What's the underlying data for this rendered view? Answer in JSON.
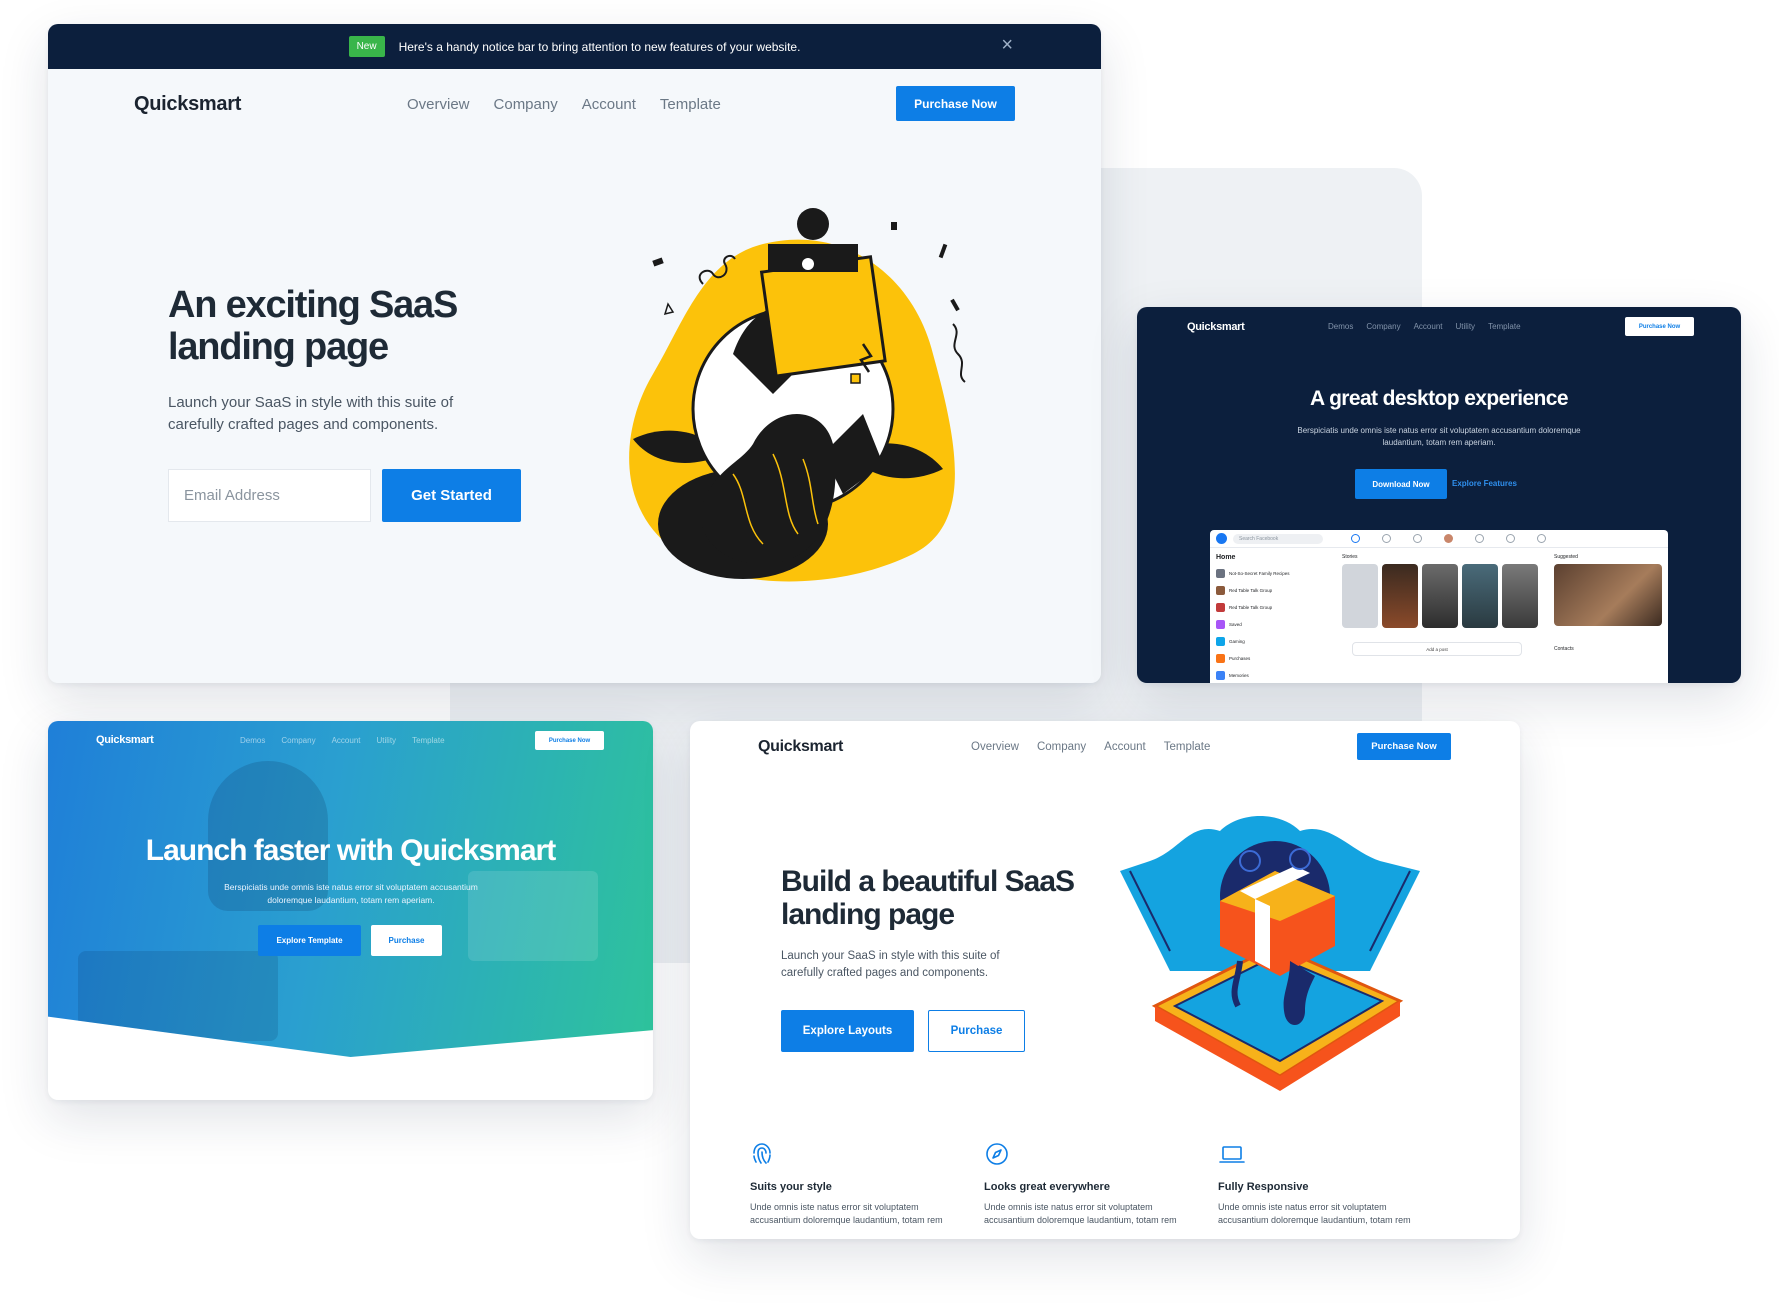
{
  "card_a": {
    "notice_badge": "New",
    "notice_text": "Here's a handy notice bar to bring attention to new features of your website.",
    "close_icon": "close-icon",
    "logo": "Quicksmart",
    "nav_links": [
      "Overview",
      "Company",
      "Account",
      "Template"
    ],
    "purchase_label": "Purchase Now",
    "title": "An exciting SaaS landing page",
    "subtitle": "Launch your SaaS in style with this suite of carefully crafted pages and components.",
    "email_placeholder": "Email Address",
    "cta_label": "Get Started"
  },
  "card_b": {
    "logo": "Quicksmart",
    "nav_links": [
      "Demos",
      "Company",
      "Account",
      "Utility",
      "Template"
    ],
    "purchase_label": "Purchase Now",
    "title": "A great desktop experience",
    "subtitle": "Berspiciatis unde omnis iste natus error sit voluptatem accusantium doloremque laudantium, totam rem aperiam.",
    "download_label": "Download Now",
    "explore_label": "Explore Features",
    "mock": {
      "search": "Search Facebook",
      "side_title": "Home",
      "side_items": [
        "Not-So-Secret Family Recipes",
        "Red Table Talk Group",
        "Red Table Talk Group",
        "Saved",
        "Gaming",
        "Purchases",
        "Memories"
      ],
      "stories_label": "Stories",
      "add_post": "Add a post",
      "suggested_label": "Suggested",
      "contacts_label": "Contacts"
    }
  },
  "card_c": {
    "logo": "Quicksmart",
    "nav_links": [
      "Demos",
      "Company",
      "Account",
      "Utility",
      "Template"
    ],
    "purchase_label": "Purchase Now",
    "title": "Launch faster with Quicksmart",
    "subtitle": "Berspiciatis unde omnis iste natus error sit voluptatem accusantium doloremque laudantium, totam rem aperiam.",
    "explore_label": "Explore Template",
    "purchase_btn": "Purchase"
  },
  "card_d": {
    "logo": "Quicksmart",
    "nav_links": [
      "Overview",
      "Company",
      "Account",
      "Template"
    ],
    "purchase_label": "Purchase Now",
    "title": "Build a beautiful SaaS landing page",
    "subtitle": "Launch your SaaS in style with this suite of carefully crafted pages and components.",
    "explore_label": "Explore Layouts",
    "purchase_btn": "Purchase",
    "features": [
      {
        "icon": "fingerprint-icon",
        "title": "Suits your style",
        "desc": "Unde omnis iste natus error sit voluptatem accusantium doloremque laudantium, totam rem"
      },
      {
        "icon": "compass-icon",
        "title": "Looks great everywhere",
        "desc": "Unde omnis iste natus error sit voluptatem accusantium doloremque laudantium, totam rem"
      },
      {
        "icon": "laptop-icon",
        "title": "Fully Responsive",
        "desc": "Unde omnis iste natus error sit voluptatem accusantium doloremque laudantium, totam rem"
      }
    ]
  },
  "colors": {
    "primary": "#0d7ee6",
    "navy": "#0c1f3d",
    "badge_green": "#39b54a",
    "illustration_yellow": "#fcc20a",
    "illustration_blue": "#14a3e0",
    "illustration_orange": "#f6531c"
  }
}
